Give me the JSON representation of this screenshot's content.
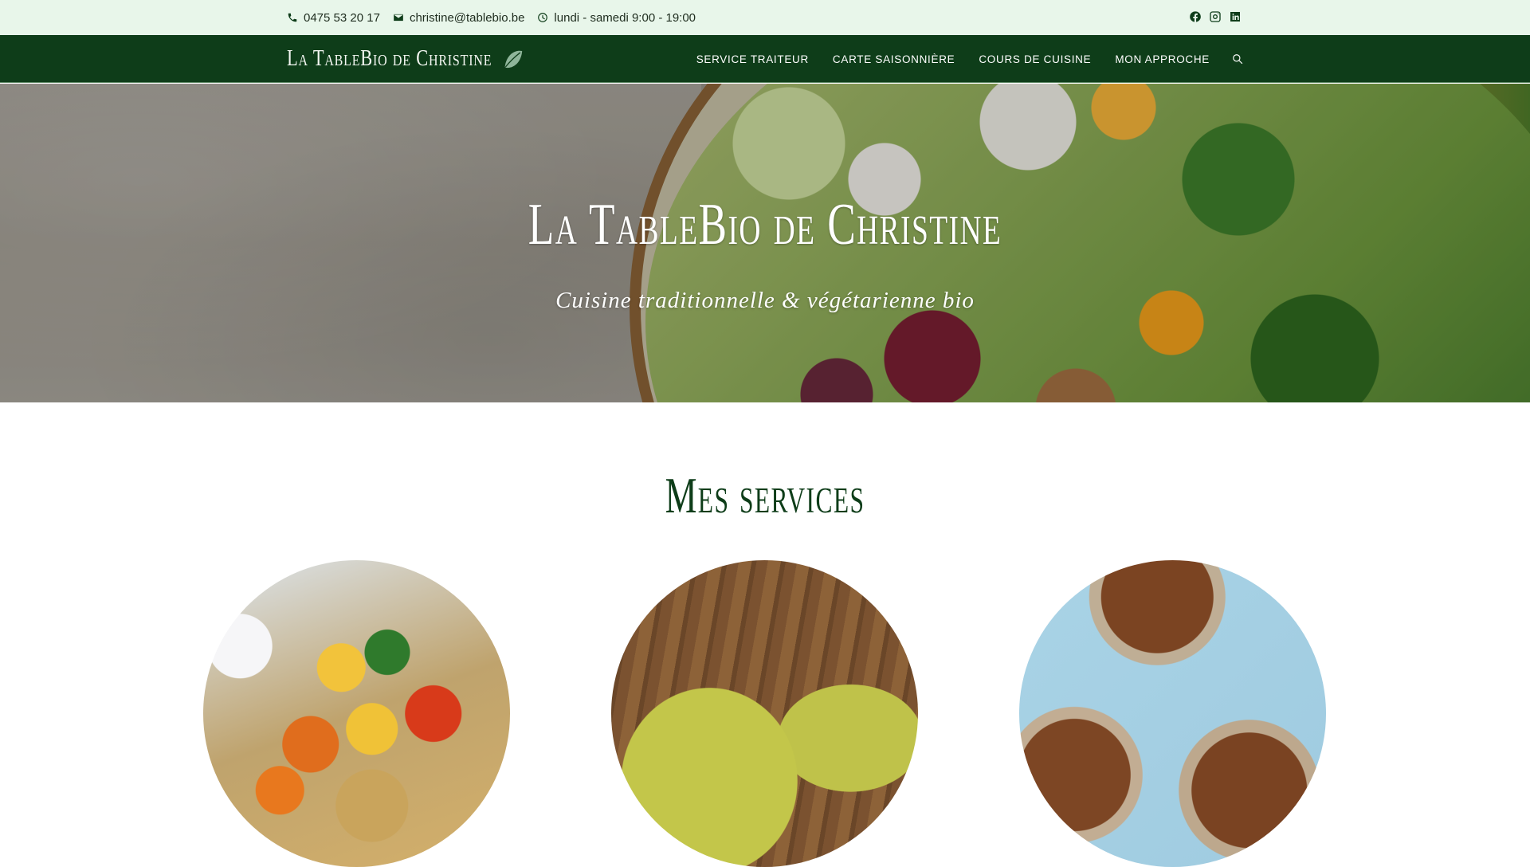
{
  "topbar": {
    "phone": "0475 53 20 17",
    "email": "christine@tablebio.be",
    "hours": "lundi - samedi 9:00 - 19:00",
    "socials": [
      "facebook-icon",
      "instagram-icon",
      "linkedin-icon"
    ]
  },
  "nav": {
    "brand": "La TableBio de Christine",
    "items": [
      "Service traiteur",
      "Carte saisonnière",
      "Cours de cuisine",
      "Mon approche"
    ]
  },
  "hero": {
    "title": "La TableBio de Christine",
    "subtitle": "Cuisine traditionnelle & végétarienne bio"
  },
  "services": {
    "title": "Mes services"
  },
  "colors": {
    "topbar_bg": "#e8f6ea",
    "nav_bg": "#0e3d19",
    "accent_green": "#0e3d19"
  }
}
